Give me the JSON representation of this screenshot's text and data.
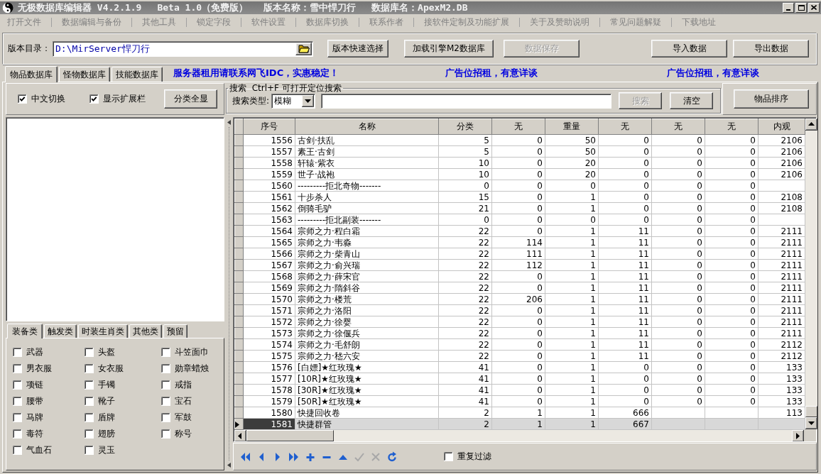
{
  "window": {
    "title_parts": [
      "无极数据库编辑器 V4.2.1.9",
      "Beta 1.0（免费版）",
      "版本名称：雪中悍刀行",
      "数据库名：ApexM2.DB"
    ]
  },
  "menu": [
    "打开文件",
    "数据编辑与备份",
    "其他工具",
    "锁定字段",
    "软件设置",
    "数据库切换",
    "联系作者",
    "接软件定制及功能扩展",
    "关于及赞助说明",
    "常见问题解疑",
    "下载地址"
  ],
  "toolbar": {
    "label": "版本目录：",
    "path": "D:\\MirServer悍刀行",
    "buttons_left": [
      {
        "label": "版本快速选择",
        "disabled": false
      },
      {
        "label": "加载引擎M2数据库",
        "disabled": false
      },
      {
        "label": "数据保存",
        "disabled": true
      }
    ],
    "buttons_right": [
      {
        "label": "导入数据",
        "disabled": false
      },
      {
        "label": "导出数据",
        "disabled": false
      }
    ]
  },
  "tabs": [
    {
      "label": "物品数据库",
      "selected": true
    },
    {
      "label": "怪物数据库",
      "selected": false
    },
    {
      "label": "技能数据库",
      "selected": false
    }
  ],
  "ads": [
    "服务器租用请联系网飞IDC，实惠稳定！",
    "广告位招租，有意详谈",
    "广告位招租，有意详谈"
  ],
  "options": [
    {
      "label": "中文切换",
      "checked": true
    },
    {
      "label": "显示扩展栏",
      "checked": true
    }
  ],
  "show_all_button": "分类全显",
  "search": {
    "legend": "搜索  Ctrl+F 可打开定位搜索",
    "type_label": "搜索类型:",
    "type_value": "模糊",
    "search_button": {
      "label": "搜索",
      "disabled": true
    },
    "clear_button": "清空"
  },
  "sort_button": "物品排序",
  "category_tabs": [
    {
      "label": "装备类",
      "selected": true
    },
    {
      "label": "触发类",
      "selected": false
    },
    {
      "label": "时装生肖类",
      "selected": false
    },
    {
      "label": "其他类",
      "selected": false
    },
    {
      "label": "预留",
      "selected": false
    }
  ],
  "categories": [
    {
      "label": "武器",
      "checked": false
    },
    {
      "label": "头盔",
      "checked": false
    },
    {
      "label": "斗笠面巾",
      "checked": false
    },
    {
      "label": "男衣服",
      "checked": false
    },
    {
      "label": "女衣服",
      "checked": false
    },
    {
      "label": "勋章蜡烛",
      "checked": false
    },
    {
      "label": "项链",
      "checked": false
    },
    {
      "label": "手镯",
      "checked": false
    },
    {
      "label": "戒指",
      "checked": false
    },
    {
      "label": "腰带",
      "checked": false
    },
    {
      "label": "靴子",
      "checked": false
    },
    {
      "label": "宝石",
      "checked": false
    },
    {
      "label": "马牌",
      "checked": false
    },
    {
      "label": "盾牌",
      "checked": false
    },
    {
      "label": "军鼓",
      "checked": false
    },
    {
      "label": "毒符",
      "checked": false
    },
    {
      "label": "翅膀",
      "checked": false
    },
    {
      "label": "称号",
      "checked": false
    },
    {
      "label": "气血石",
      "checked": false
    },
    {
      "label": "灵玉",
      "checked": false
    }
  ],
  "table": {
    "columns": [
      {
        "label": "序号",
        "kind": "number"
      },
      {
        "label": "名称",
        "kind": "text"
      },
      {
        "label": "分类",
        "kind": "number"
      },
      {
        "label": "无",
        "kind": "number"
      },
      {
        "label": "重量",
        "kind": "number"
      },
      {
        "label": "无",
        "kind": "number"
      },
      {
        "label": "无",
        "kind": "number"
      },
      {
        "label": "无",
        "kind": "number"
      },
      {
        "label": "内观",
        "kind": "number"
      }
    ],
    "rows": [
      {
        "cells": [
          "1556",
          "古剑·扶乱",
          "5",
          "0",
          "50",
          "0",
          "0",
          "0",
          "2106"
        ],
        "selected": false
      },
      {
        "cells": [
          "1557",
          "素王·古剑",
          "5",
          "0",
          "50",
          "0",
          "0",
          "0",
          "2106"
        ],
        "selected": false
      },
      {
        "cells": [
          "1558",
          "轩辕·紫衣",
          "10",
          "0",
          "20",
          "0",
          "0",
          "0",
          "2106"
        ],
        "selected": false
      },
      {
        "cells": [
          "1559",
          "世子·战袍",
          "10",
          "0",
          "20",
          "0",
          "0",
          "0",
          "2106"
        ],
        "selected": false
      },
      {
        "cells": [
          "1560",
          "---------拒北奇物-------",
          "0",
          "0",
          "0",
          "0",
          "0",
          "0",
          null
        ],
        "selected": false
      },
      {
        "cells": [
          "1561",
          "十步杀人",
          "15",
          "0",
          "1",
          "0",
          "0",
          "0",
          "2108"
        ],
        "selected": false
      },
      {
        "cells": [
          "1562",
          "倒骑毛驴",
          "21",
          "0",
          "1",
          "0",
          "0",
          "0",
          "2108"
        ],
        "selected": false
      },
      {
        "cells": [
          "1563",
          "---------拒北副装-------",
          "0",
          "0",
          "0",
          "0",
          "0",
          "0",
          null
        ],
        "selected": false
      },
      {
        "cells": [
          "1564",
          "宗师之力·程白霜",
          "22",
          "0",
          "1",
          "11",
          "0",
          "0",
          "2111"
        ],
        "selected": false
      },
      {
        "cells": [
          "1565",
          "宗师之力·韦淼",
          "22",
          "114",
          "1",
          "11",
          "0",
          "0",
          "2111"
        ],
        "selected": false
      },
      {
        "cells": [
          "1566",
          "宗师之力·柴青山",
          "22",
          "111",
          "1",
          "11",
          "0",
          "0",
          "2111"
        ],
        "selected": false
      },
      {
        "cells": [
          "1567",
          "宗师之力·俞兴瑞",
          "22",
          "112",
          "1",
          "11",
          "0",
          "0",
          "2111"
        ],
        "selected": false
      },
      {
        "cells": [
          "1568",
          "宗师之力·薛宋官",
          "22",
          "0",
          "1",
          "11",
          "0",
          "0",
          "2111"
        ],
        "selected": false
      },
      {
        "cells": [
          "1569",
          "宗师之力·隋斜谷",
          "22",
          "0",
          "1",
          "11",
          "0",
          "0",
          "2111"
        ],
        "selected": false
      },
      {
        "cells": [
          "1570",
          "宗师之力·楼荒",
          "22",
          "206",
          "1",
          "11",
          "0",
          "0",
          "2111"
        ],
        "selected": false
      },
      {
        "cells": [
          "1571",
          "宗师之力·洛阳",
          "22",
          "0",
          "1",
          "11",
          "0",
          "0",
          "2111"
        ],
        "selected": false
      },
      {
        "cells": [
          "1572",
          "宗师之力·徐婴",
          "22",
          "0",
          "1",
          "11",
          "0",
          "0",
          "2111"
        ],
        "selected": false
      },
      {
        "cells": [
          "1573",
          "宗师之力·徐偃兵",
          "22",
          "0",
          "1",
          "11",
          "0",
          "0",
          "2111"
        ],
        "selected": false
      },
      {
        "cells": [
          "1574",
          "宗师之力·毛舒朗",
          "22",
          "0",
          "1",
          "11",
          "0",
          "0",
          "2112"
        ],
        "selected": false
      },
      {
        "cells": [
          "1575",
          "宗师之力·嵇六安",
          "22",
          "0",
          "1",
          "11",
          "0",
          "0",
          "2112"
        ],
        "selected": false
      },
      {
        "cells": [
          "1576",
          "[白嫖]★红玫瑰★",
          "41",
          "0",
          "1",
          "0",
          "0",
          "0",
          "133"
        ],
        "selected": false
      },
      {
        "cells": [
          "1577",
          "[10R]★红玫瑰★",
          "41",
          "0",
          "1",
          "0",
          "0",
          "0",
          "133"
        ],
        "selected": false
      },
      {
        "cells": [
          "1578",
          "[30R]★红玫瑰★",
          "41",
          "0",
          "1",
          "0",
          "0",
          "0",
          "133"
        ],
        "selected": false
      },
      {
        "cells": [
          "1579",
          "[50R]★红玫瑰★",
          "41",
          "0",
          "1",
          "0",
          "0",
          "0",
          "133"
        ],
        "selected": false
      },
      {
        "cells": [
          "1580",
          "快捷回收卷",
          "2",
          "1",
          "1",
          "666",
          null,
          null,
          "113"
        ],
        "selected": false
      },
      {
        "cells": [
          "1581",
          "快捷群管",
          "2",
          "1",
          "1",
          "667",
          null,
          null,
          null
        ],
        "selected": true
      }
    ]
  },
  "navigator": [
    {
      "kind": "first",
      "disabled": false
    },
    {
      "kind": "prior",
      "disabled": false
    },
    {
      "kind": "next",
      "disabled": false
    },
    {
      "kind": "last",
      "disabled": false
    },
    {
      "kind": "insert",
      "disabled": false
    },
    {
      "kind": "delete",
      "disabled": false
    },
    {
      "kind": "edit",
      "disabled": false
    },
    {
      "kind": "post",
      "disabled": true
    },
    {
      "kind": "cancel",
      "disabled": true
    },
    {
      "kind": "refresh",
      "disabled": false
    }
  ],
  "filter": {
    "label": "重复过滤",
    "checked": false
  }
}
